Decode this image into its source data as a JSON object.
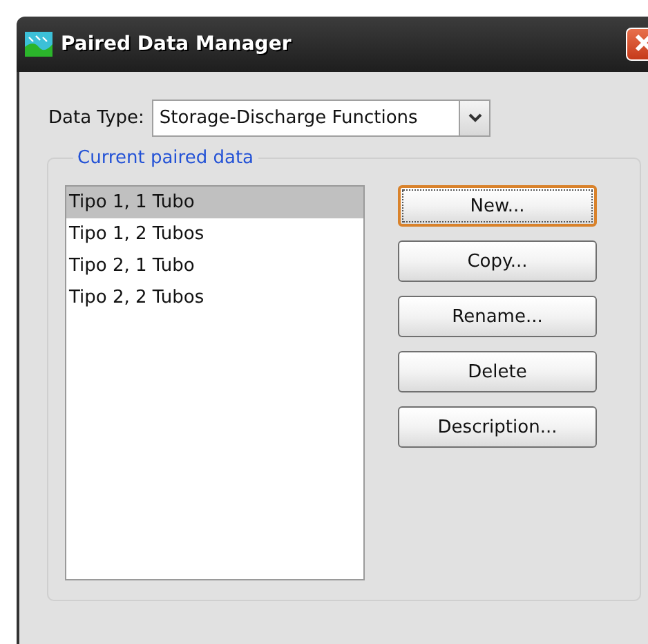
{
  "window": {
    "title": "Paired Data Manager"
  },
  "data_type": {
    "label": "Data Type:",
    "value": "Storage-Discharge Functions"
  },
  "group": {
    "title": "Current paired data"
  },
  "items": [
    {
      "label": "Tipo 1, 1 Tubo",
      "selected": true
    },
    {
      "label": "Tipo 1, 2 Tubos",
      "selected": false
    },
    {
      "label": "Tipo 2, 1 Tubo",
      "selected": false
    },
    {
      "label": "Tipo 2, 2 Tubos",
      "selected": false
    }
  ],
  "buttons": [
    {
      "label": "New...",
      "focused": true
    },
    {
      "label": "Copy...",
      "focused": false
    },
    {
      "label": "Rename...",
      "focused": false
    },
    {
      "label": "Delete",
      "focused": false
    },
    {
      "label": "Description...",
      "focused": false
    }
  ]
}
